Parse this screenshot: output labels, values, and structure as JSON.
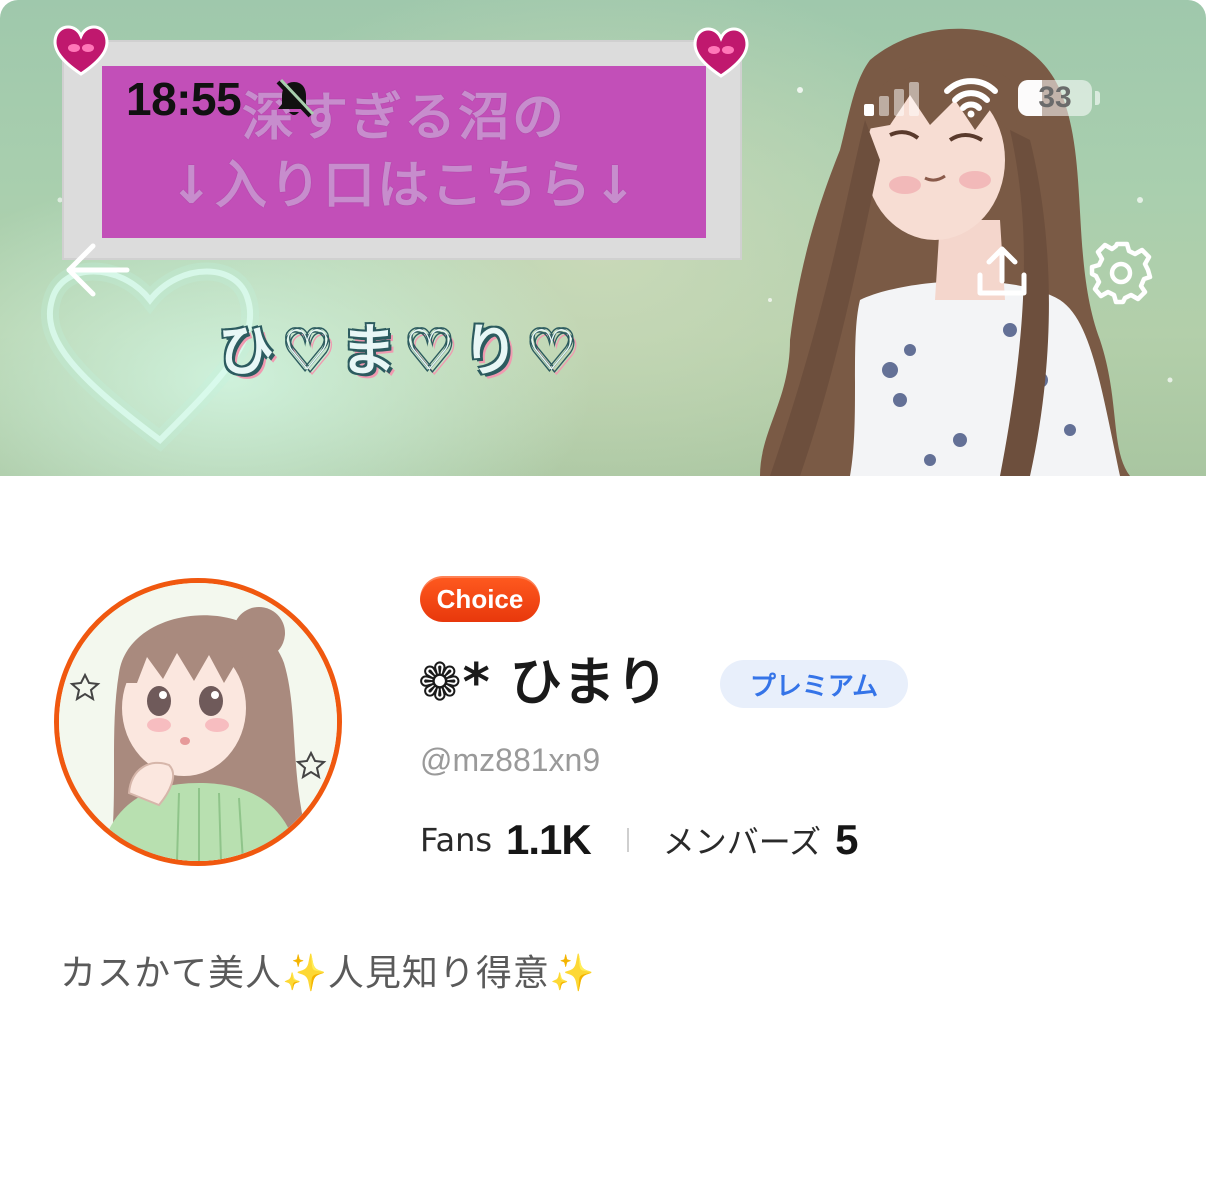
{
  "status_bar": {
    "time": "18:55",
    "battery": "33",
    "battery_level": 0.33,
    "icons": [
      "bell-off-icon",
      "cellular-signal-icon",
      "wifi-icon",
      "battery-icon"
    ]
  },
  "cover": {
    "sign_line_1": "深すぎる沼の",
    "sign_line_2": "↓入り口はこちら↓",
    "name_art": "ひ♡ま♡り♡"
  },
  "nav": {
    "back_icon": "back-arrow-icon",
    "share_icon": "share-upload-icon",
    "settings_icon": "gear-icon"
  },
  "profile": {
    "choice_badge": "Choice",
    "name": "❁* ひまり",
    "premium_badge": "プレミアム",
    "handle": "@mz881xn9",
    "stats": {
      "fans_label": "Fans",
      "fans_value": "1.1K",
      "members_label": "メンバーズ",
      "members_value": "5"
    },
    "bio": "カスかて美人✨人見知り得意✨"
  },
  "colors": {
    "accent_orange": "#f0580f",
    "premium_blue": "#3574e8",
    "premium_bg": "#e8effb",
    "sign_magenta": "#c24fb8"
  }
}
